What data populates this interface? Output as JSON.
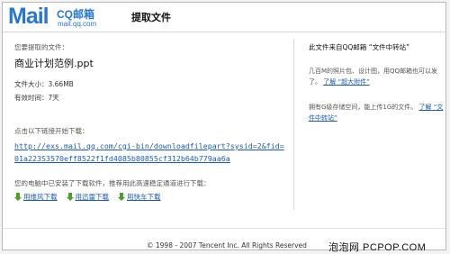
{
  "logo": {
    "text": "Mail",
    "cq": "CQ邮箱",
    "domain": "mail.qq.com"
  },
  "header": {
    "title": "提取文件"
  },
  "main": {
    "intro": "您要提取的文件：",
    "filename": "商业计划范例.ppt",
    "size": "文件大小：3.66MB",
    "valid": "有效时间：7天",
    "click_hint": "点击以下链接开始下载：",
    "download_url": "http://exs.mail.qq.com/cgi-bin/downloadfilepart?sysid=2&fid=01a223S3570eff8522f1fd4085b80855cf312b64b779aa6a",
    "soft_hint": "您的电脑中已安装了下载软件，推荐用此高速稳定通道进行下载：",
    "tools": [
      "用维风下载",
      "用迅雷下载",
      "用快车下载"
    ]
  },
  "sidebar": {
    "title": "此文件来自QQ邮箱 “文件中转站”",
    "p1_text": "几百M的照片包、设计图，用QQ邮箱也可以发了。",
    "p1_link": "了解 “超大附件”",
    "p2_text": "拥有G级存储空间，能上传1G的文件。",
    "p2_link": "了解 “文件中转站”"
  },
  "footer": {
    "copyright": "© 1998 - 2007 Tencent Inc. All Rights Reserved"
  },
  "watermark": "泡泡网 PCPOP.COM",
  "colors": {
    "brand": "#2a78c9",
    "link": "#1a5bb5",
    "download_arrow": "#4aa02a"
  }
}
